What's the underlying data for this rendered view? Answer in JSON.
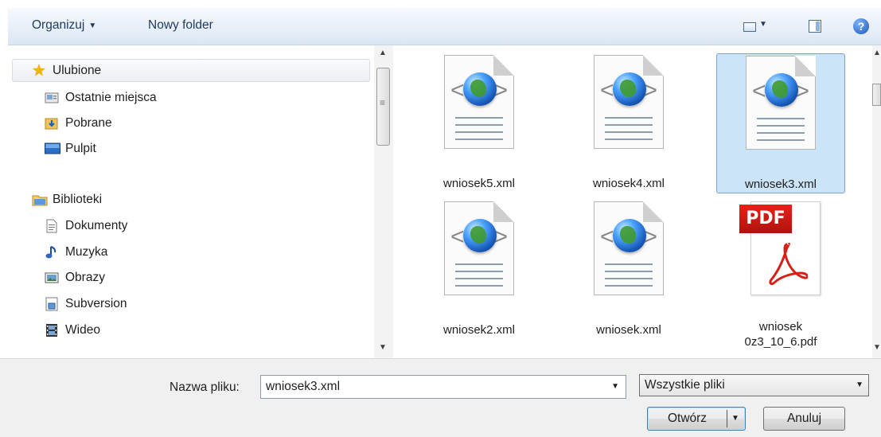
{
  "toolbar": {
    "organize_label": "Organizuj",
    "new_folder_label": "Nowy folder"
  },
  "nav": {
    "favorites": "Ulubione",
    "favorites_items": [
      "Ostatnie miejsca",
      "Pobrane",
      "Pulpit"
    ],
    "libraries": "Biblioteki",
    "library_items": [
      "Dokumenty",
      "Muzyka",
      "Obrazy",
      "Subversion",
      "Wideo"
    ]
  },
  "files": [
    {
      "name": "wniosek5.xml",
      "type": "xml",
      "selected": false
    },
    {
      "name": "wniosek4.xml",
      "type": "xml",
      "selected": false
    },
    {
      "name": "wniosek3.xml",
      "type": "xml",
      "selected": true
    },
    {
      "name": "wniosek2.xml",
      "type": "xml",
      "selected": false
    },
    {
      "name": "wniosek.xml",
      "type": "xml",
      "selected": false
    },
    {
      "name_line1": "wniosek",
      "name_line2": "0z3_10_6.pdf",
      "type": "pdf",
      "selected": false,
      "badge": "PDF"
    }
  ],
  "bottom": {
    "filename_label": "Nazwa pliku:",
    "filename_value": "wniosek3.xml",
    "filetype_value": "Wszystkie pliki",
    "open_label": "Otwórz",
    "cancel_label": "Anuluj"
  },
  "colors": {
    "selection": "#cce4f7",
    "selection_border": "#7da2ce",
    "toolbar_text": "#1e395b"
  }
}
